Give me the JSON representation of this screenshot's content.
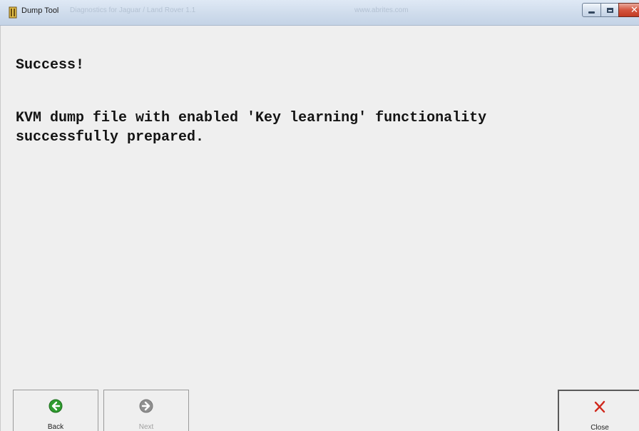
{
  "window": {
    "title": "Dump Tool",
    "title_suffix": "Diagnostics for Jaguar / Land Rover 1.1",
    "title_url": "www.abrites.com",
    "caption_buttons": {
      "minimize_icon": "minimize-icon",
      "maximize_icon": "maximize-icon",
      "close_glyph": "✕"
    }
  },
  "message": {
    "heading": "Success!",
    "body": "KVM dump file with enabled 'Key learning' functionality\nsuccessfully prepared."
  },
  "buttons": {
    "back": {
      "label": "Back",
      "icon": "arrow-left-icon",
      "color": "#2e9b2e",
      "enabled": true
    },
    "next": {
      "label": "Next",
      "icon": "arrow-right-icon",
      "color": "#9a9a9a",
      "enabled": false
    },
    "close": {
      "label": "Close",
      "icon": "close-x-icon",
      "color": "#d0281c",
      "enabled": true
    }
  }
}
